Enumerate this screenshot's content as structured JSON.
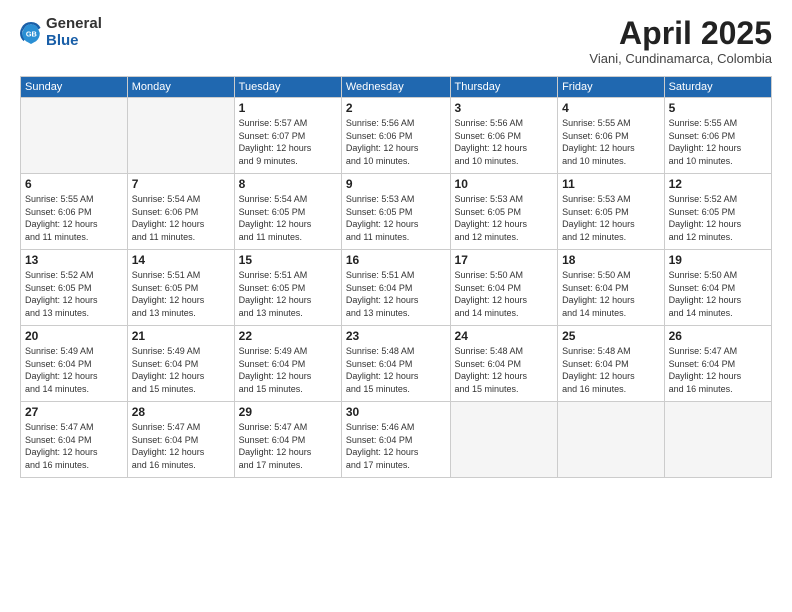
{
  "logo": {
    "general": "General",
    "blue": "Blue"
  },
  "header": {
    "month": "April 2025",
    "location": "Viani, Cundinamarca, Colombia"
  },
  "weekdays": [
    "Sunday",
    "Monday",
    "Tuesday",
    "Wednesday",
    "Thursday",
    "Friday",
    "Saturday"
  ],
  "weeks": [
    [
      {
        "day": "",
        "empty": true
      },
      {
        "day": "",
        "empty": true
      },
      {
        "day": "1",
        "sunrise": "5:57 AM",
        "sunset": "6:07 PM",
        "daylight": "12 hours and 9 minutes."
      },
      {
        "day": "2",
        "sunrise": "5:56 AM",
        "sunset": "6:06 PM",
        "daylight": "12 hours and 10 minutes."
      },
      {
        "day": "3",
        "sunrise": "5:56 AM",
        "sunset": "6:06 PM",
        "daylight": "12 hours and 10 minutes."
      },
      {
        "day": "4",
        "sunrise": "5:55 AM",
        "sunset": "6:06 PM",
        "daylight": "12 hours and 10 minutes."
      },
      {
        "day": "5",
        "sunrise": "5:55 AM",
        "sunset": "6:06 PM",
        "daylight": "12 hours and 10 minutes."
      }
    ],
    [
      {
        "day": "6",
        "sunrise": "5:55 AM",
        "sunset": "6:06 PM",
        "daylight": "12 hours and 11 minutes."
      },
      {
        "day": "7",
        "sunrise": "5:54 AM",
        "sunset": "6:06 PM",
        "daylight": "12 hours and 11 minutes."
      },
      {
        "day": "8",
        "sunrise": "5:54 AM",
        "sunset": "6:05 PM",
        "daylight": "12 hours and 11 minutes."
      },
      {
        "day": "9",
        "sunrise": "5:53 AM",
        "sunset": "6:05 PM",
        "daylight": "12 hours and 11 minutes."
      },
      {
        "day": "10",
        "sunrise": "5:53 AM",
        "sunset": "6:05 PM",
        "daylight": "12 hours and 12 minutes."
      },
      {
        "day": "11",
        "sunrise": "5:53 AM",
        "sunset": "6:05 PM",
        "daylight": "12 hours and 12 minutes."
      },
      {
        "day": "12",
        "sunrise": "5:52 AM",
        "sunset": "6:05 PM",
        "daylight": "12 hours and 12 minutes."
      }
    ],
    [
      {
        "day": "13",
        "sunrise": "5:52 AM",
        "sunset": "6:05 PM",
        "daylight": "12 hours and 13 minutes."
      },
      {
        "day": "14",
        "sunrise": "5:51 AM",
        "sunset": "6:05 PM",
        "daylight": "12 hours and 13 minutes."
      },
      {
        "day": "15",
        "sunrise": "5:51 AM",
        "sunset": "6:05 PM",
        "daylight": "12 hours and 13 minutes."
      },
      {
        "day": "16",
        "sunrise": "5:51 AM",
        "sunset": "6:04 PM",
        "daylight": "12 hours and 13 minutes."
      },
      {
        "day": "17",
        "sunrise": "5:50 AM",
        "sunset": "6:04 PM",
        "daylight": "12 hours and 14 minutes."
      },
      {
        "day": "18",
        "sunrise": "5:50 AM",
        "sunset": "6:04 PM",
        "daylight": "12 hours and 14 minutes."
      },
      {
        "day": "19",
        "sunrise": "5:50 AM",
        "sunset": "6:04 PM",
        "daylight": "12 hours and 14 minutes."
      }
    ],
    [
      {
        "day": "20",
        "sunrise": "5:49 AM",
        "sunset": "6:04 PM",
        "daylight": "12 hours and 14 minutes."
      },
      {
        "day": "21",
        "sunrise": "5:49 AM",
        "sunset": "6:04 PM",
        "daylight": "12 hours and 15 minutes."
      },
      {
        "day": "22",
        "sunrise": "5:49 AM",
        "sunset": "6:04 PM",
        "daylight": "12 hours and 15 minutes."
      },
      {
        "day": "23",
        "sunrise": "5:48 AM",
        "sunset": "6:04 PM",
        "daylight": "12 hours and 15 minutes."
      },
      {
        "day": "24",
        "sunrise": "5:48 AM",
        "sunset": "6:04 PM",
        "daylight": "12 hours and 15 minutes."
      },
      {
        "day": "25",
        "sunrise": "5:48 AM",
        "sunset": "6:04 PM",
        "daylight": "12 hours and 16 minutes."
      },
      {
        "day": "26",
        "sunrise": "5:47 AM",
        "sunset": "6:04 PM",
        "daylight": "12 hours and 16 minutes."
      }
    ],
    [
      {
        "day": "27",
        "sunrise": "5:47 AM",
        "sunset": "6:04 PM",
        "daylight": "12 hours and 16 minutes."
      },
      {
        "day": "28",
        "sunrise": "5:47 AM",
        "sunset": "6:04 PM",
        "daylight": "12 hours and 16 minutes."
      },
      {
        "day": "29",
        "sunrise": "5:47 AM",
        "sunset": "6:04 PM",
        "daylight": "12 hours and 17 minutes."
      },
      {
        "day": "30",
        "sunrise": "5:46 AM",
        "sunset": "6:04 PM",
        "daylight": "12 hours and 17 minutes."
      },
      {
        "day": "",
        "empty": true
      },
      {
        "day": "",
        "empty": true
      },
      {
        "day": "",
        "empty": true
      }
    ]
  ],
  "labels": {
    "sunrise": "Sunrise:",
    "sunset": "Sunset:",
    "daylight": "Daylight:"
  }
}
